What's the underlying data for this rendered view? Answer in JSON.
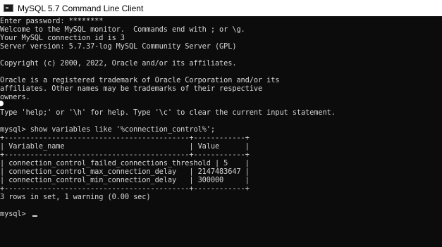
{
  "window": {
    "title": "MySQL 5.7 Command Line Client",
    "icon": "console-window-icon"
  },
  "console": {
    "intro_lines": [
      "Enter password: ********",
      "Welcome to the MySQL monitor.  Commands end with ; or \\g.",
      "Your MySQL connection id is 3",
      "Server version: 5.7.37-log MySQL Community Server (GPL)",
      "",
      "Copyright (c) 2000, 2022, Oracle and/or its affiliates.",
      "",
      "Oracle is a registered trademark of Oracle Corporation and/or its",
      "affiliates. Other names may be trademarks of their respective",
      "owners.",
      "",
      "Type 'help;' or '\\h' for help. Type '\\c' to clear the current input statement.",
      ""
    ],
    "query": "mysql> show variables like '%connection_control%';",
    "table_lines": [
      "+-------------------------------------------+------------+",
      "| Variable_name                             | Value      |",
      "+-------------------------------------------+------------+",
      "| connection_control_failed_connections_threshold | 5    |",
      "| connection_control_max_connection_delay   | 2147483647 |",
      "| connection_control_min_connection_delay   | 300000     |",
      "+-------------------------------------------+------------+"
    ],
    "result_summary": "3 rows in set, 1 warning (0.00 sec)",
    "prompt": "mysql> "
  },
  "colors": {
    "console_background": "#0c0c0c",
    "console_text": "#d6d6d6",
    "titlebar_background": "#ffffff"
  }
}
